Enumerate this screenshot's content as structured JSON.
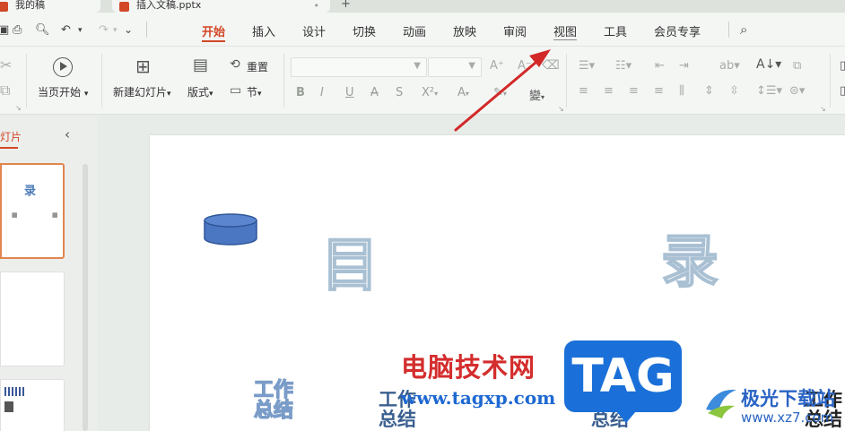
{
  "window": {
    "tabs": [
      {
        "label": "我的稿",
        "active": false
      },
      {
        "label": "插入文稿.pptx",
        "active": true
      }
    ]
  },
  "menu": {
    "tabs": [
      "开始",
      "插入",
      "设计",
      "切换",
      "动画",
      "放映",
      "审阅",
      "视图",
      "工具",
      "会员专享"
    ],
    "active_tab": "开始"
  },
  "ribbon": {
    "from_current": "当页开始",
    "new_slide": "新建幻灯片",
    "layout": "版式",
    "reset": "重置",
    "section": "节",
    "font_name": "",
    "font_size": ""
  },
  "panel": {
    "label": "灯片",
    "thumb1_char": "录"
  },
  "slide": {
    "title_char_1": "目",
    "title_char_2": "录",
    "item_line1": "工作",
    "item_line2": "总结"
  },
  "watermarks": {
    "site_name": "电脑技术网",
    "site_url": "www.tagxp.com",
    "tag": "TAG",
    "brand2_name": "极光下载站",
    "brand2_url": "www.xz7.com"
  },
  "colors": {
    "accent": "#d24726",
    "arrow": "#d22828",
    "shape_fill": "#4a76c2"
  }
}
